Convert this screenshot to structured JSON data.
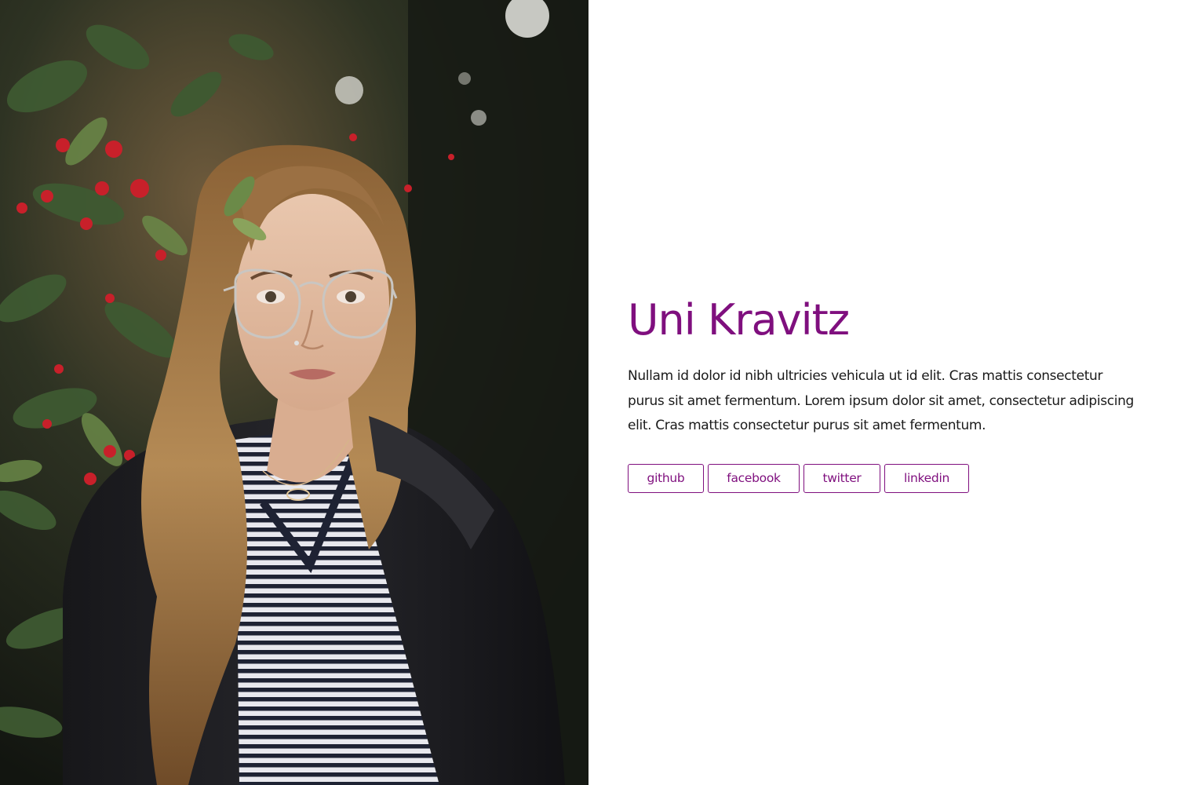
{
  "profile": {
    "name": "Uni Kravitz",
    "bio": "Nullam id dolor id nibh ultricies vehicula ut id elit. Cras mattis consectetur purus sit amet fermentum. Lorem ipsum dolor sit amet, consectetur adipiscing elit. Cras mattis consectetur purus sit amet fermentum.",
    "photo": "portrait-photo"
  },
  "social_links": [
    {
      "label": "github"
    },
    {
      "label": "facebook"
    },
    {
      "label": "twitter"
    },
    {
      "label": "linkedin"
    }
  ],
  "colors": {
    "accent": "#7f0f7e",
    "text": "#1a1a1a",
    "background": "#ffffff"
  }
}
